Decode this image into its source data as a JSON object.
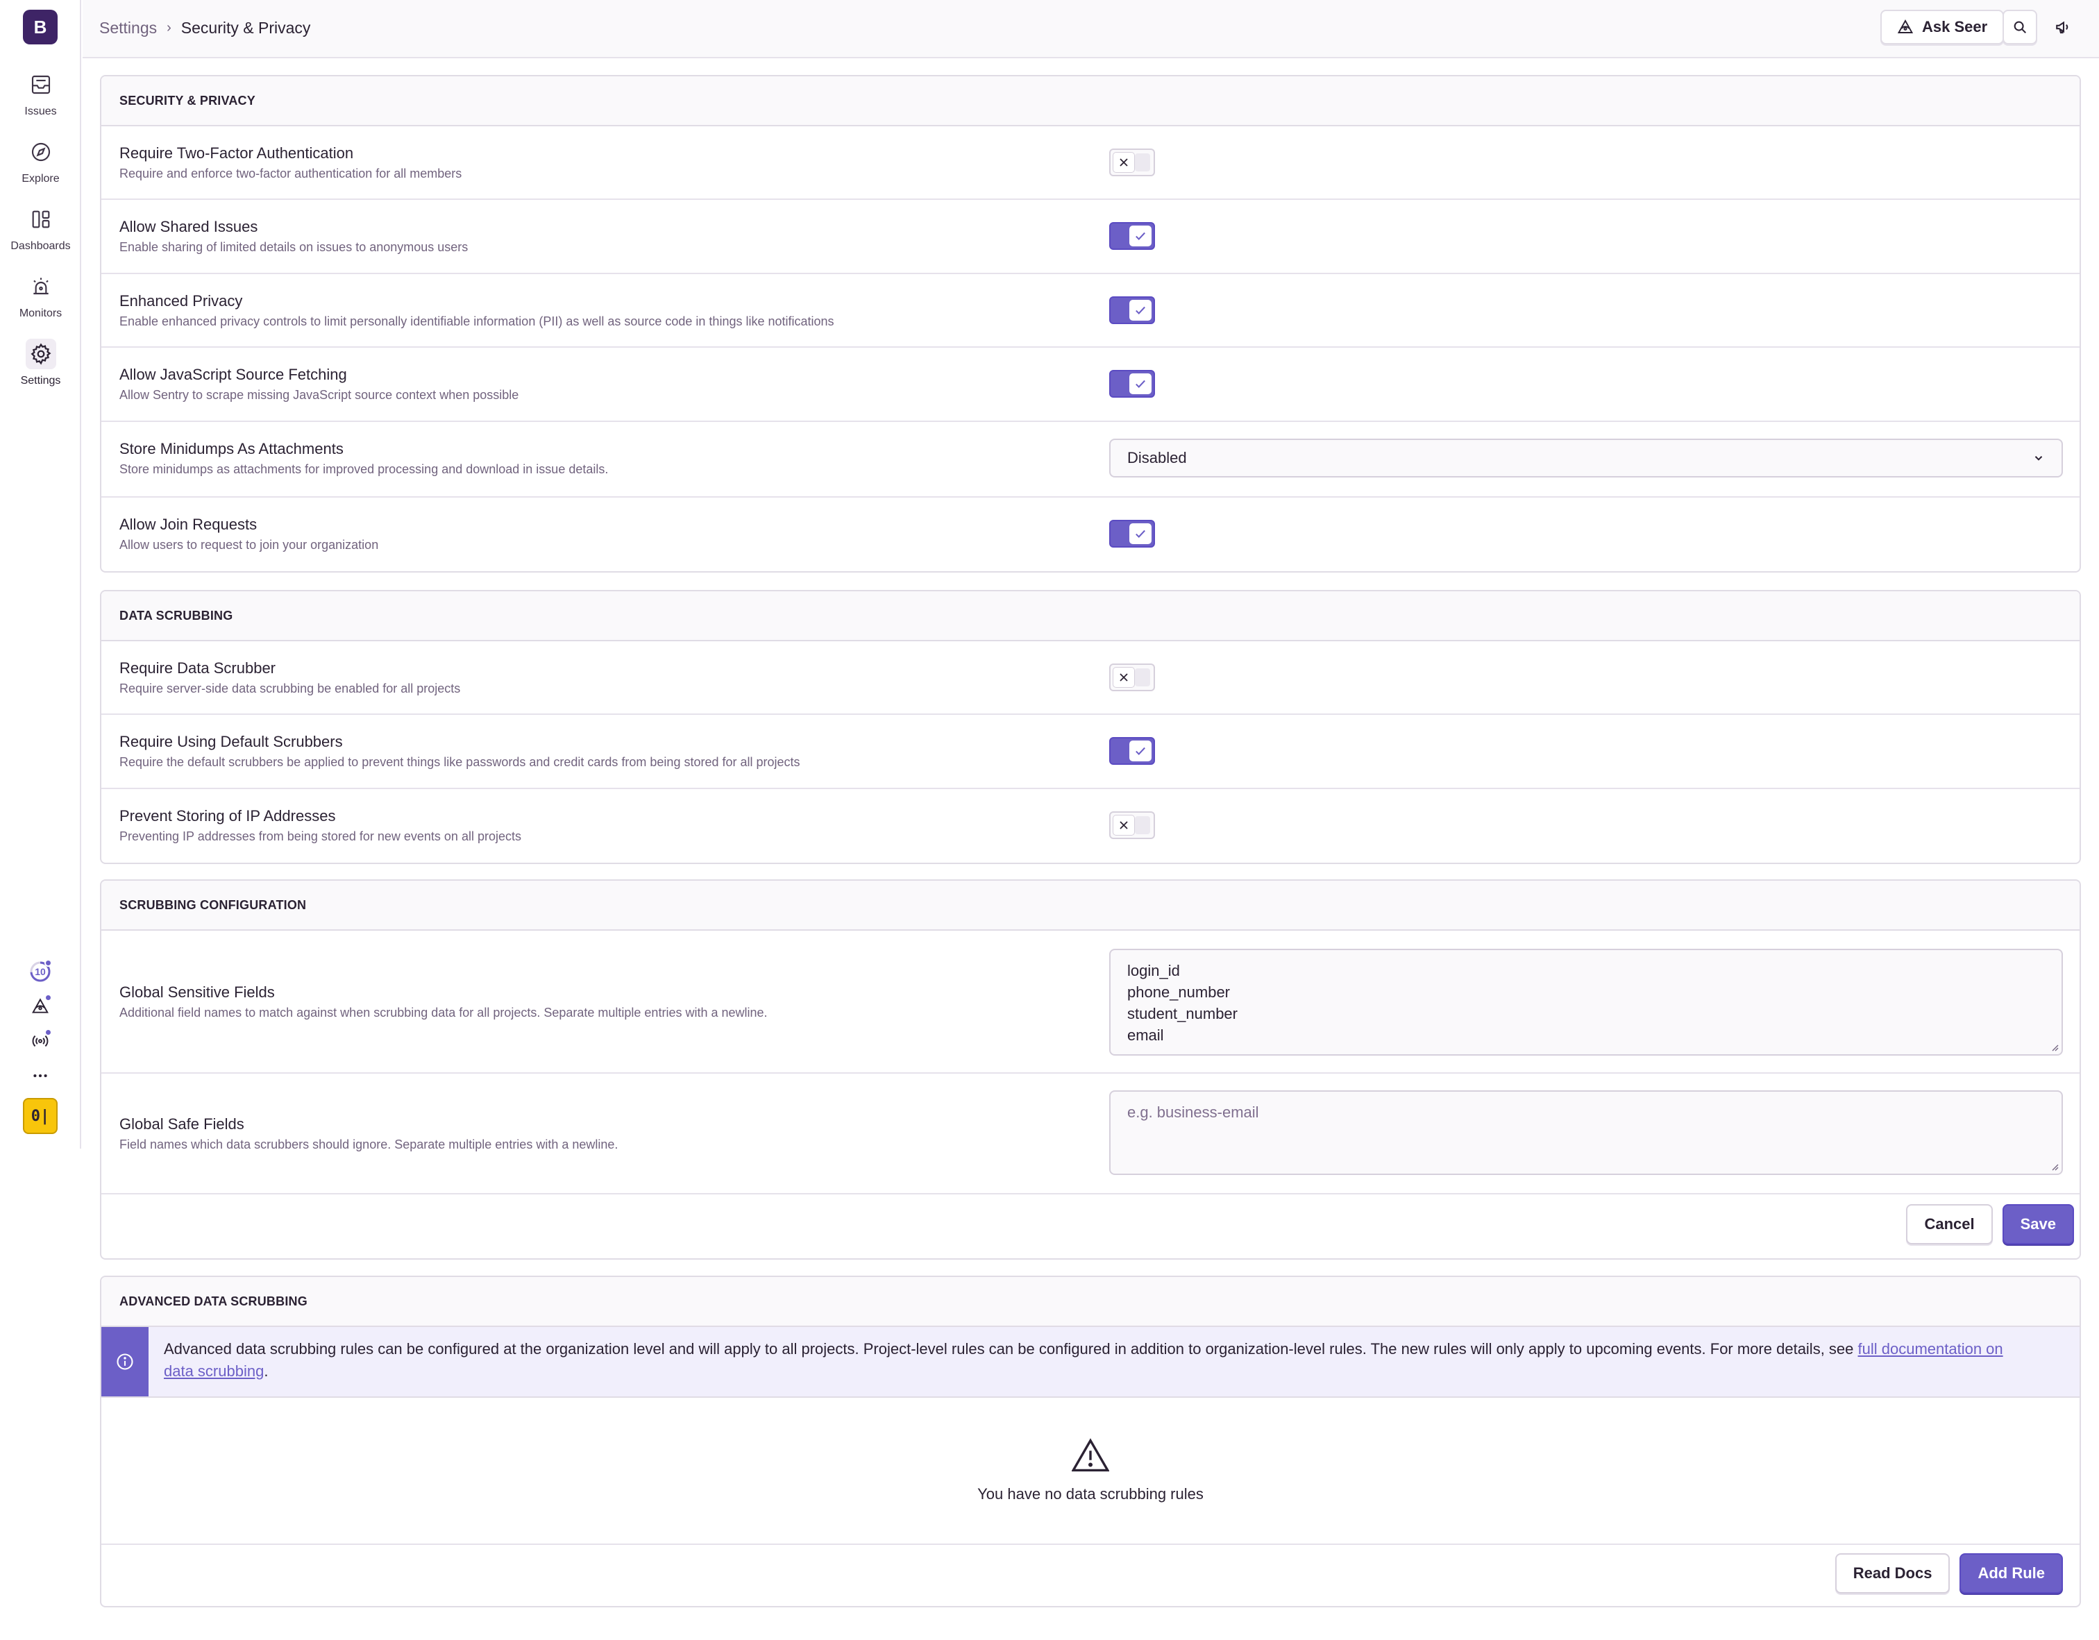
{
  "sidebar": {
    "org_initial": "B",
    "items": [
      {
        "label": "Issues",
        "icon": "inbox-icon"
      },
      {
        "label": "Explore",
        "icon": "compass-icon"
      },
      {
        "label": "Dashboards",
        "icon": "dashboards-icon"
      },
      {
        "label": "Monitors",
        "icon": "siren-icon"
      },
      {
        "label": "Settings",
        "icon": "gear-icon"
      }
    ],
    "onboarding_count": "10",
    "toolbar_label": "0|"
  },
  "header": {
    "breadcrumb_parent": "Settings",
    "breadcrumb_current": "Security & Privacy",
    "ask_seer_label": "Ask Seer"
  },
  "security": {
    "heading": "SECURITY & PRIVACY",
    "rows": [
      {
        "title": "Require Two-Factor Authentication",
        "desc": "Require and enforce two-factor authentication for all members",
        "enabled": false
      },
      {
        "title": "Allow Shared Issues",
        "desc": "Enable sharing of limited details on issues to anonymous users",
        "enabled": true
      },
      {
        "title": "Enhanced Privacy",
        "desc": "Enable enhanced privacy controls to limit personally identifiable information (PII) as well as source code in things like notifications",
        "enabled": true
      },
      {
        "title": "Allow JavaScript Source Fetching",
        "desc": "Allow Sentry to scrape missing JavaScript source context when possible",
        "enabled": true
      },
      {
        "title": "Store Minidumps As Attachments",
        "desc": "Store minidumps as attachments for improved processing and download in issue details.",
        "select_value": "Disabled"
      },
      {
        "title": "Allow Join Requests",
        "desc": "Allow users to request to join your organization",
        "enabled": true
      }
    ]
  },
  "data_scrubbing": {
    "heading": "DATA SCRUBBING",
    "rows": [
      {
        "title": "Require Data Scrubber",
        "desc": "Require server-side data scrubbing be enabled for all projects",
        "enabled": false
      },
      {
        "title": "Require Using Default Scrubbers",
        "desc": "Require the default scrubbers be applied to prevent things like passwords and credit cards from being stored for all projects",
        "enabled": true
      },
      {
        "title": "Prevent Storing of IP Addresses",
        "desc": "Preventing IP addresses from being stored for new events on all projects",
        "enabled": false
      }
    ]
  },
  "scrubbing_config": {
    "heading": "SCRUBBING CONFIGURATION",
    "sensitive": {
      "title": "Global Sensitive Fields",
      "desc": "Additional field names to match against when scrubbing data for all projects. Separate multiple entries with a newline.",
      "values": [
        "login_id",
        "phone_number",
        "student_number",
        "email"
      ]
    },
    "safe": {
      "title": "Global Safe Fields",
      "desc": "Field names which data scrubbers should ignore. Separate multiple entries with a newline.",
      "placeholder": "e.g. business-email"
    },
    "cancel_label": "Cancel",
    "save_label": "Save"
  },
  "advanced": {
    "heading": "ADVANCED DATA SCRUBBING",
    "alert_text": "Advanced data scrubbing rules can be configured at the organization level and will apply to all projects. Project-level rules can be configured in addition to organization-level rules. The new rules will only apply to upcoming events. For more details, see ",
    "alert_link": "full documentation on data scrubbing",
    "alert_end": ".",
    "empty_message": "You have no data scrubbing rules",
    "read_docs_label": "Read Docs",
    "add_rule_label": "Add Rule"
  },
  "colors": {
    "accent": "#6c5fc7",
    "org_badge": "#3e2466",
    "toolbar_yellow": "#f8c50b"
  }
}
